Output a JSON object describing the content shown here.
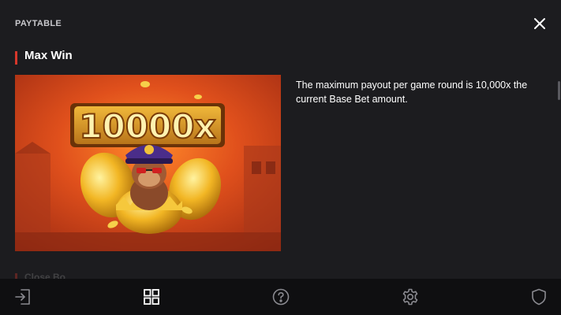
{
  "header": {
    "title": "PAYTABLE"
  },
  "section": {
    "title": "Max Win",
    "description": "The maximum payout per game round is 10,000x the current Base Bet amount."
  },
  "hero": {
    "multiplier_text": "10000x"
  },
  "next_section": {
    "title": "Close Bo..."
  },
  "icons": {
    "close": "close-icon",
    "exit": "exit-icon",
    "paytable": "grid-icon",
    "help": "help-icon",
    "settings": "gear-icon",
    "responsible": "shield-icon"
  },
  "colors": {
    "background": "#1c1c1f",
    "footer": "#0f0f11",
    "accent": "#d6372b"
  }
}
